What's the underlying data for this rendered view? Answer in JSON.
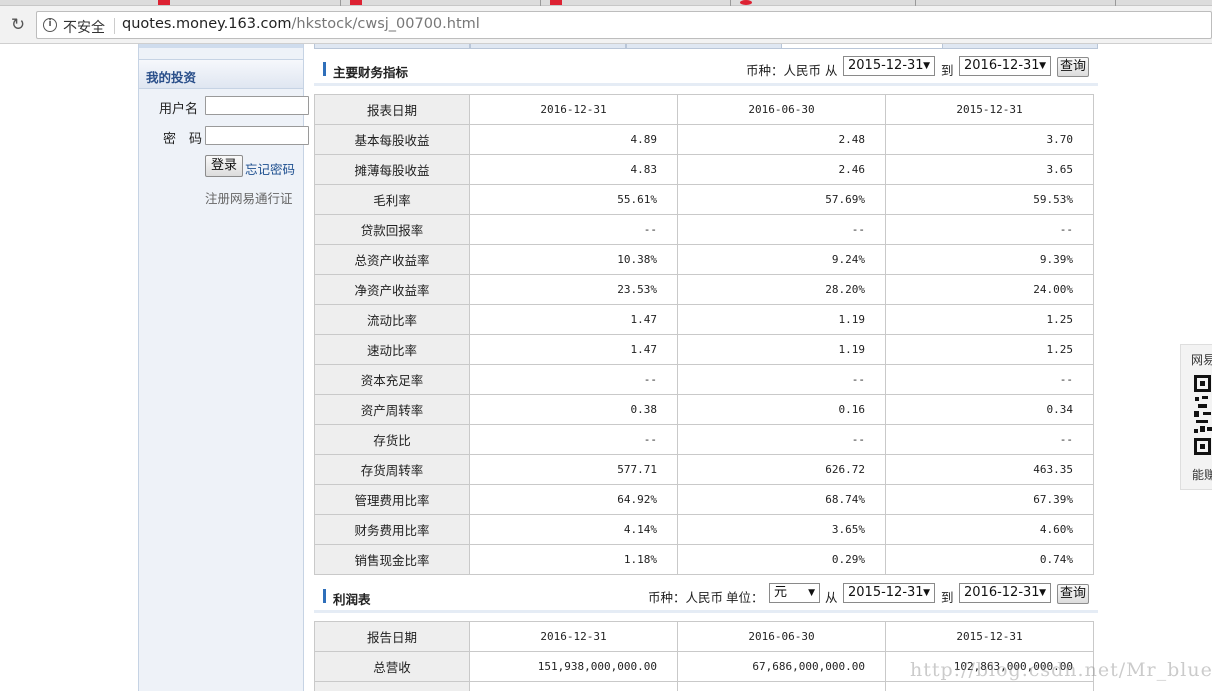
{
  "browser": {
    "security_label": "不安全",
    "url_host": "quotes.money.163.com",
    "url_path": "/hkstock/cwsj_00700.html"
  },
  "sidebar": {
    "title": "我的投资",
    "username_label": "用户名",
    "password_label": "密　码",
    "username_value": "",
    "password_value": "",
    "login_button": "登录",
    "forgot_link": "忘记密码",
    "register_link": "注册网易通行证"
  },
  "indicators": {
    "title": "主要财务指标",
    "currency_label": "币种：人民币",
    "from_label": "从",
    "to_label": "到",
    "from_value": "2015-12-31",
    "to_value": "2016-12-31",
    "query_button": "查询",
    "header": {
      "label": "报表日期",
      "dates": [
        "2016-12-31",
        "2016-06-30",
        "2015-12-31"
      ]
    },
    "rows": [
      {
        "label": "基本每股收益",
        "values": [
          "4.89",
          "2.48",
          "3.70"
        ]
      },
      {
        "label": "摊薄每股收益",
        "values": [
          "4.83",
          "2.46",
          "3.65"
        ]
      },
      {
        "label": "毛利率",
        "values": [
          "55.61%",
          "57.69%",
          "59.53%"
        ]
      },
      {
        "label": "贷款回报率",
        "values": [
          "--",
          "--",
          "--"
        ]
      },
      {
        "label": "总资产收益率",
        "values": [
          "10.38%",
          "9.24%",
          "9.39%"
        ]
      },
      {
        "label": "净资产收益率",
        "values": [
          "23.53%",
          "28.20%",
          "24.00%"
        ]
      },
      {
        "label": "流动比率",
        "values": [
          "1.47",
          "1.19",
          "1.25"
        ]
      },
      {
        "label": "速动比率",
        "values": [
          "1.47",
          "1.19",
          "1.25"
        ]
      },
      {
        "label": "资本充足率",
        "values": [
          "--",
          "--",
          "--"
        ]
      },
      {
        "label": "资产周转率",
        "values": [
          "0.38",
          "0.16",
          "0.34"
        ]
      },
      {
        "label": "存货比",
        "values": [
          "--",
          "--",
          "--"
        ]
      },
      {
        "label": "存货周转率",
        "values": [
          "577.71",
          "626.72",
          "463.35"
        ]
      },
      {
        "label": "管理费用比率",
        "values": [
          "64.92%",
          "68.74%",
          "67.39%"
        ]
      },
      {
        "label": "财务费用比率",
        "values": [
          "4.14%",
          "3.65%",
          "4.60%"
        ]
      },
      {
        "label": "销售现金比率",
        "values": [
          "1.18%",
          "0.29%",
          "0.74%"
        ]
      }
    ]
  },
  "income": {
    "title": "利润表",
    "currency_label": "币种：人民币",
    "unit_label": "单位：",
    "unit_value": "元",
    "from_label": "从",
    "to_label": "到",
    "from_value": "2015-12-31",
    "to_value": "2016-12-31",
    "query_button": "查询",
    "header": {
      "label": "报告日期",
      "dates": [
        "2016-12-31",
        "2016-06-30",
        "2015-12-31"
      ]
    },
    "rows": [
      {
        "label": "总营收",
        "values": [
          "151,938,000,000.00",
          "67,686,000,000.00",
          "102,863,000,000.00"
        ]
      },
      {
        "label": "",
        "values": [
          "",
          "",
          ""
        ]
      }
    ]
  },
  "floater": {
    "top_text": "网易",
    "bottom_text": "能赚"
  },
  "watermark": "http://blog.csdn.net/Mr_blueD"
}
